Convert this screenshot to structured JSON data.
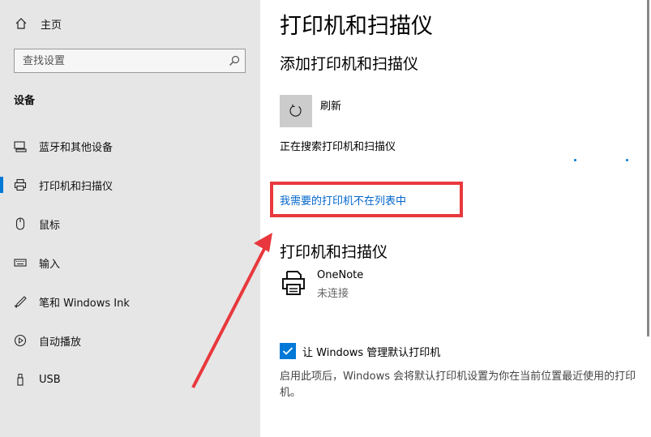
{
  "sidebar": {
    "home_label": "主页",
    "search_placeholder": "查找设置",
    "section_title": "设备",
    "items": [
      {
        "label": "蓝牙和其他设备",
        "icon": "bluetooth-devices-icon"
      },
      {
        "label": "打印机和扫描仪",
        "icon": "printer-icon",
        "selected": true
      },
      {
        "label": "鼠标",
        "icon": "mouse-icon"
      },
      {
        "label": "输入",
        "icon": "keyboard-icon"
      },
      {
        "label": "笔和 Windows Ink",
        "icon": "pen-icon"
      },
      {
        "label": "自动播放",
        "icon": "autoplay-icon"
      },
      {
        "label": "USB",
        "icon": "usb-icon"
      }
    ]
  },
  "main": {
    "title": "打印机和扫描仪",
    "add_heading": "添加打印机和扫描仪",
    "refresh_label": "刷新",
    "searching_text": "正在搜索打印机和扫描仪",
    "not_listed_link": "我需要的打印机不在列表中",
    "printers_heading": "打印机和扫描仪",
    "printers": [
      {
        "name": "OneNote",
        "status": "未连接"
      }
    ],
    "default_checkbox": {
      "label": "让 Windows 管理默认打印机",
      "checked": true
    },
    "default_description": "启用此项后，Windows 会将默认打印机设置为你在当前位置最近使用的打印机。"
  },
  "colors": {
    "accent": "#0078d7",
    "annotation": "#e8383d",
    "link": "#0066cc"
  }
}
